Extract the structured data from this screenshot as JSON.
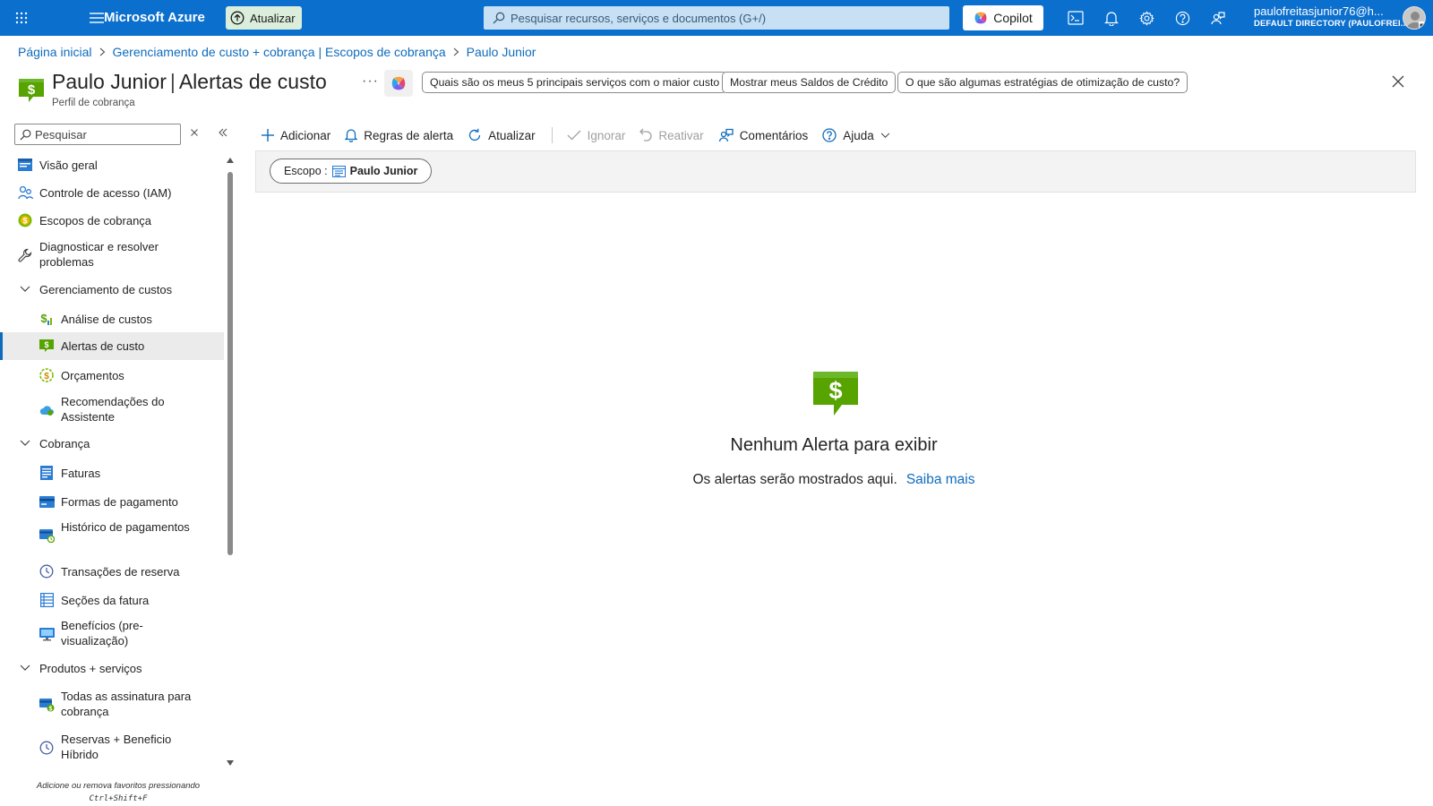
{
  "topbar": {
    "brand": "Microsoft Azure",
    "upgrade_label": "Atualizar",
    "search_placeholder": "Pesquisar recursos, serviços e documentos (G+/)",
    "copilot_label": "Copilot",
    "user_email": "paulofreitasjunior76@h...",
    "user_directory": "DEFAULT DIRECTORY (PAULOFREI...",
    "colors": {
      "bar": "#0b6fce",
      "search": "#c7e0f4"
    }
  },
  "breadcrumb": [
    "Página inicial",
    "Gerenciamento de custo + cobrança | Escopos de cobrança",
    "Paulo Junior"
  ],
  "header": {
    "resource_name": "Paulo Junior",
    "separator": "|",
    "page_name": "Alertas de custo",
    "subtitle": "Perfil de cobrança",
    "more": "···",
    "chips": [
      "Quais são os meus 5 principais serviços com o maior custo",
      "Mostrar meus Saldos de Crédito",
      "O que são algumas estratégias de otimização de custo?"
    ]
  },
  "sidebar": {
    "search_placeholder": "Pesquisar",
    "items": [
      {
        "label": "Visão geral",
        "icon": "overview-icon"
      },
      {
        "label": "Controle de acesso (IAM)",
        "icon": "people-icon"
      },
      {
        "label": "Escopos de cobrança",
        "icon": "billing-scope-icon"
      },
      {
        "label": "Diagnosticar e resolver problemas",
        "icon": "wrench-icon"
      },
      {
        "label": "Gerenciamento de custos",
        "icon": "chevron-down-icon"
      },
      {
        "label": "Análise de custos",
        "icon": "cost-analysis-icon"
      },
      {
        "label": "Alertas de custo",
        "icon": "cost-alert-icon"
      },
      {
        "label": "Orçamentos",
        "icon": "budget-icon"
      },
      {
        "label": "Recomendações do Assistente",
        "icon": "advisor-icon"
      },
      {
        "label": "Cobrança",
        "icon": "chevron-down-icon"
      },
      {
        "label": "Faturas",
        "icon": "invoice-icon"
      },
      {
        "label": "Formas de pagamento",
        "icon": "payment-card-icon"
      },
      {
        "label": "Histórico de pagamentos",
        "icon": "payment-history-icon"
      },
      {
        "label": "Transações de reserva",
        "icon": "clock-icon"
      },
      {
        "label": "Seções da fatura",
        "icon": "invoice-sections-icon"
      },
      {
        "label": "Benefícios (pre-visualização)",
        "icon": "monitor-icon"
      },
      {
        "label": "Produtos + serviços",
        "icon": "chevron-down-icon"
      },
      {
        "label": "Todas as assinatura para cobrança",
        "icon": "subscription-icon"
      },
      {
        "label": "Reservas + Beneficio Híbrido",
        "icon": "clock-icon"
      }
    ],
    "hint_text": "Adicione ou remova favoritos pressionando",
    "hint_keys": "Ctrl+Shift+F"
  },
  "commands": [
    {
      "label": "Adicionar",
      "icon": "plus-icon",
      "enabled": true
    },
    {
      "label": "Regras de alerta",
      "icon": "bell-icon",
      "enabled": true
    },
    {
      "label": "Atualizar",
      "icon": "refresh-icon",
      "enabled": true
    },
    {
      "label": "Ignorar",
      "icon": "checkmark-icon",
      "enabled": false
    },
    {
      "label": "Reativar",
      "icon": "undo-icon",
      "enabled": false
    },
    {
      "label": "Comentários",
      "icon": "feedback-icon",
      "enabled": true
    },
    {
      "label": "Ajuda",
      "icon": "help-icon",
      "enabled": true
    }
  ],
  "filter": {
    "scope_label": "Escopo :",
    "scope_value": "Paulo Junior"
  },
  "empty_state": {
    "title": "Nenhum Alerta para exibir",
    "message": "Os alertas serão mostrados aqui.",
    "link": "Saiba mais",
    "accent": "#57a300"
  }
}
